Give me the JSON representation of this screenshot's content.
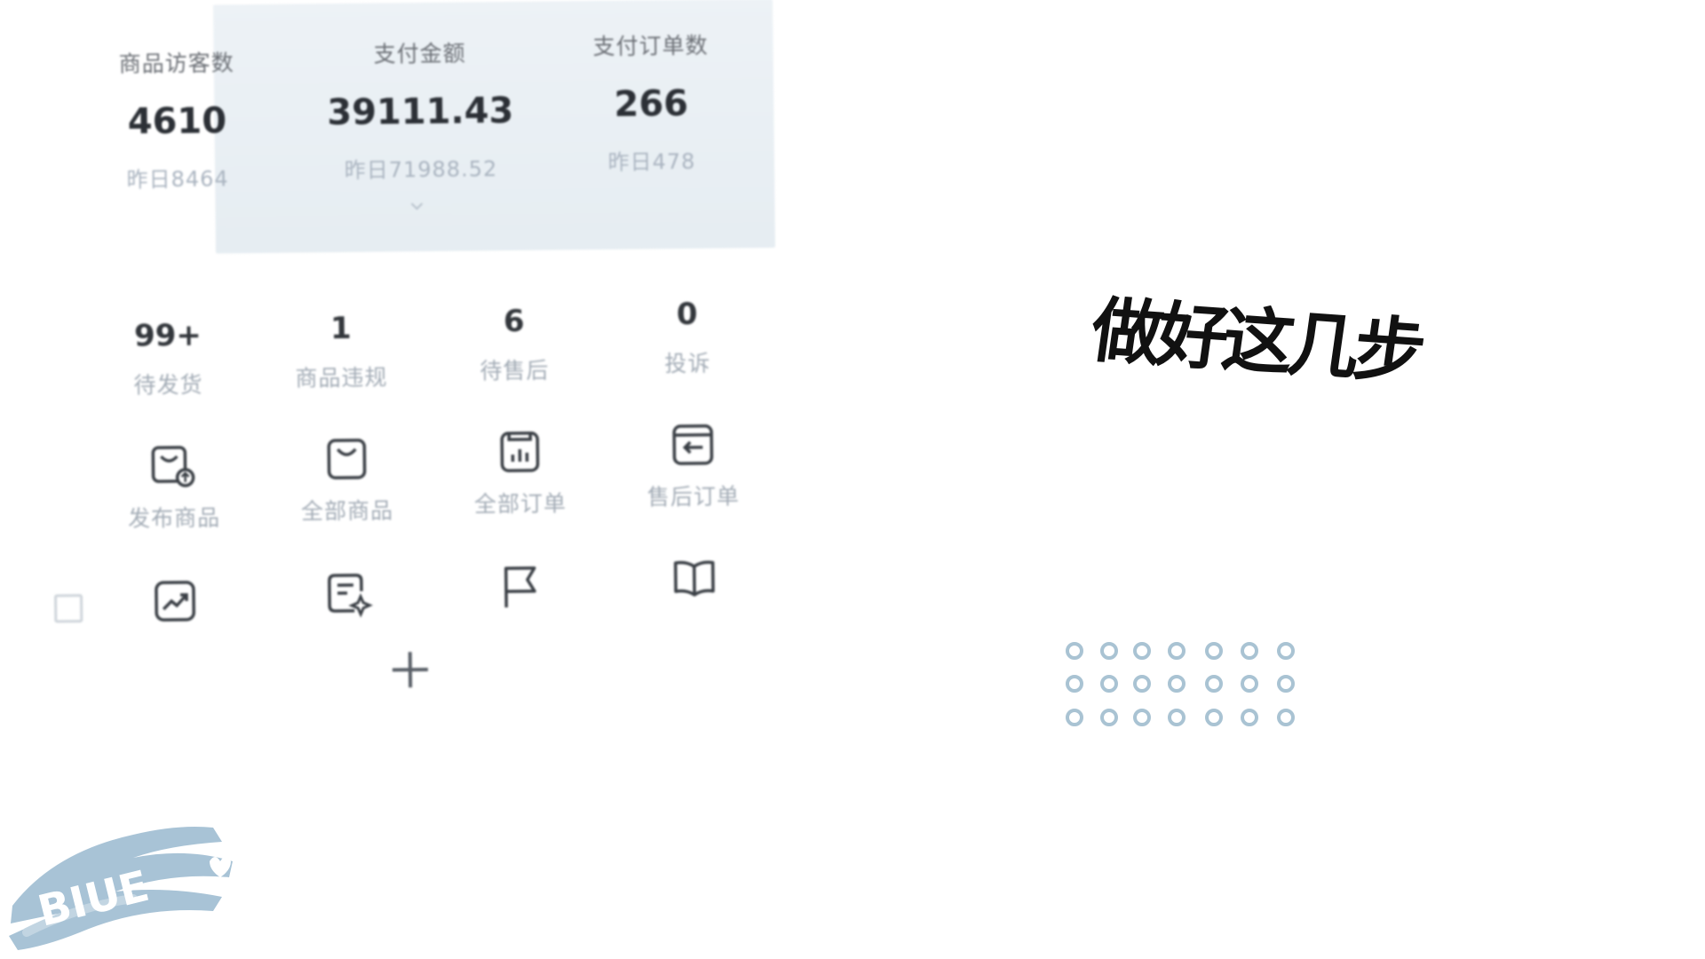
{
  "stats": [
    {
      "label": "商品访客数",
      "value": "4610",
      "sub": "昨日8464"
    },
    {
      "label": "支付金额",
      "value": "39111.43",
      "sub": "昨日71988.52"
    },
    {
      "label": "支付订单数",
      "value": "266",
      "sub": "昨日478"
    }
  ],
  "badges": [
    {
      "count": "99+",
      "label": "待发货"
    },
    {
      "count": "1",
      "label": "商品违规"
    },
    {
      "count": "6",
      "label": "待售后"
    },
    {
      "count": "0",
      "label": "投诉"
    }
  ],
  "tools_row1": [
    {
      "label": "发布商品",
      "icon": "publish-product-icon"
    },
    {
      "label": "全部商品",
      "icon": "shopping-bag-icon"
    },
    {
      "label": "全部订单",
      "icon": "orders-icon"
    },
    {
      "label": "售后订单",
      "icon": "return-orders-icon"
    }
  ],
  "tools_row2": [
    {
      "icon": "trend-chart-icon"
    },
    {
      "icon": "document-edit-icon"
    },
    {
      "icon": "flag-icon"
    },
    {
      "icon": "book-icon"
    }
  ],
  "headline": "做好这几步",
  "logo_text": "BIUE",
  "colors": {
    "panel": "#e8eef3",
    "accent_blue": "#9db8cc",
    "text_dark": "#2c3036",
    "text_muted": "#a3acb6"
  }
}
